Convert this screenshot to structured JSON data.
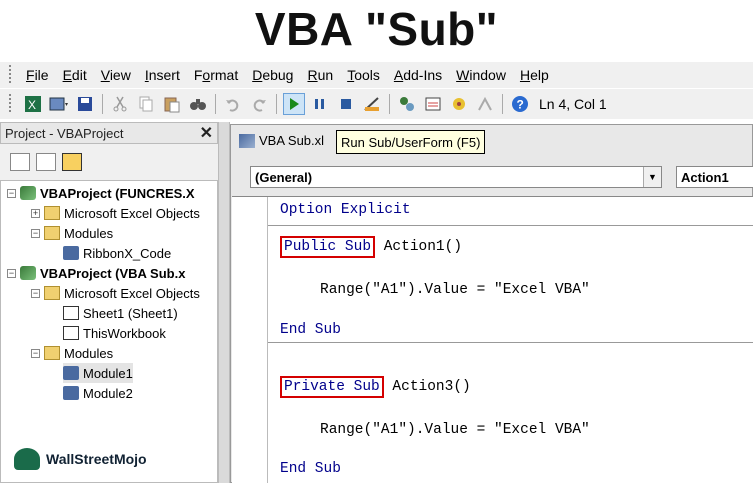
{
  "heading": "VBA \"Sub\"",
  "menu": [
    "File",
    "Edit",
    "View",
    "Insert",
    "Format",
    "Debug",
    "Run",
    "Tools",
    "Add-Ins",
    "Window",
    "Help"
  ],
  "menu_underline": [
    "F",
    "E",
    "V",
    "I",
    "o",
    "D",
    "R",
    "T",
    "A",
    "W",
    "H"
  ],
  "toolbar": {
    "status": "Ln 4, Col 1"
  },
  "project_panel": {
    "title": "Project - VBAProject",
    "close": "✕",
    "tree": [
      {
        "label": "VBAProject (FUNCRES.X",
        "icon": "project-icon"
      },
      {
        "label": "Microsoft Excel Objects",
        "icon": "folder-icon"
      },
      {
        "label": "Modules",
        "icon": "folder-icon"
      },
      {
        "label": "RibbonX_Code",
        "icon": "module-icon"
      },
      {
        "label": "VBAProject (VBA Sub.x",
        "icon": "project-icon"
      },
      {
        "label": "Microsoft Excel Objects",
        "icon": "folder-icon"
      },
      {
        "label": "Sheet1 (Sheet1)",
        "icon": "sheet-icon"
      },
      {
        "label": "ThisWorkbook",
        "icon": "workbook-icon"
      },
      {
        "label": "Modules",
        "icon": "folder-icon"
      },
      {
        "label": "Module1",
        "icon": "module-icon"
      },
      {
        "label": "Module2",
        "icon": "module-icon"
      }
    ]
  },
  "logo_text": "WallStreetMojo",
  "code_window": {
    "title": "VBA Sub.xl",
    "tooltip": "Run Sub/UserForm (F5)",
    "object_combo": "(General)",
    "proc_combo": "Action1",
    "lines": {
      "l1": "Option Explicit",
      "l2_kw": "Public Sub",
      "l2_rest": " Action1()",
      "l3": "Range(\"A1\").Value = \"Excel VBA\"",
      "l4": "End Sub",
      "l5_kw": "Private Sub",
      "l5_rest": " Action3()",
      "l6": "Range(\"A1\").Value = \"Excel VBA\"",
      "l7": "End Sub"
    }
  },
  "colors": {
    "keyword": "#00008b",
    "highlight_box": "#d40000",
    "tooltip_bg": "#ffffe0"
  }
}
